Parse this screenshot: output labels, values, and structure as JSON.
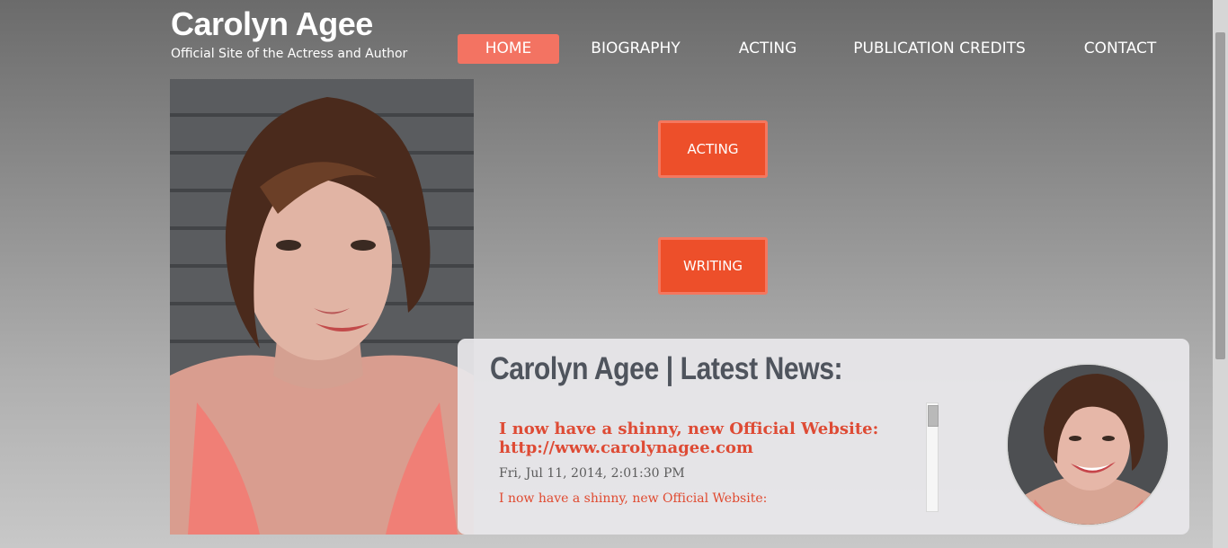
{
  "site": {
    "title": "Carolyn Agee",
    "tagline": "Official Site of the Actress and Author"
  },
  "nav": {
    "items": [
      {
        "label": "HOME",
        "active": true
      },
      {
        "label": "BIOGRAPHY",
        "active": false
      },
      {
        "label": "ACTING",
        "active": false
      },
      {
        "label": "PUBLICATION CREDITS",
        "active": false
      },
      {
        "label": "CONTACT",
        "active": false
      }
    ]
  },
  "buttons": {
    "acting": "ACTING",
    "writing": "WRITING"
  },
  "news": {
    "heading": "Carolyn Agee | Latest News:",
    "items": [
      {
        "title": "I now have a shinny, new Official Website: http://www.carolynagee.com",
        "date": "Fri, Jul 11, 2014, 2:01:30 PM",
        "body": "I now have a shinny, new Official Website:"
      }
    ]
  },
  "colors": {
    "accent": "#f37362",
    "button": "#ed4f2a",
    "news_link": "#de4b35",
    "heading": "#4f545d"
  }
}
